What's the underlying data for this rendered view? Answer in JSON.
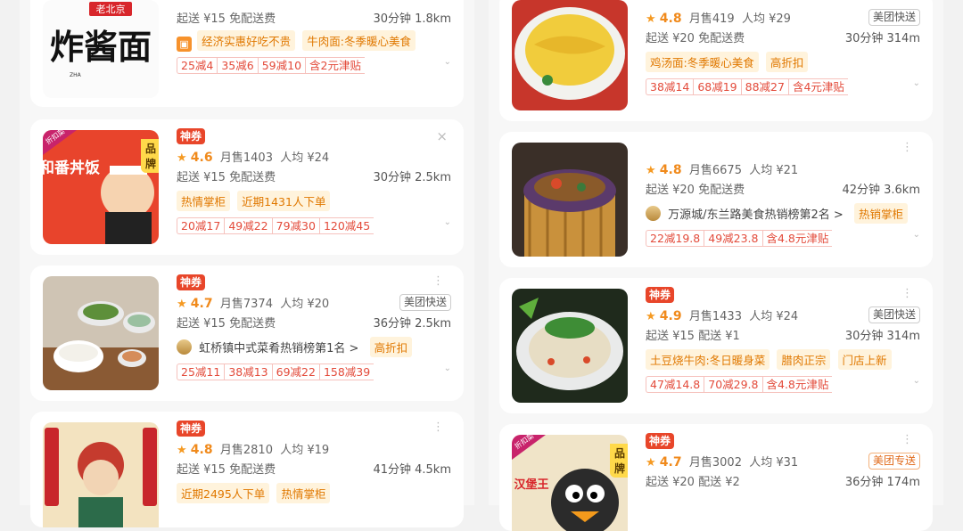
{
  "left": [
    {
      "name_art": "炸酱面",
      "name_art_top": "老北京",
      "delivery": "起送 ¥15  免配送费",
      "time_dist": "30分钟 1.8km",
      "tags": [
        "经济实惠好吃不贵",
        "牛肉面:冬季暖心美食"
      ],
      "deals": [
        "25减4",
        "35减6",
        "59减10",
        "含2元津贴"
      ]
    },
    {
      "brand": "品牌",
      "badge": "神券",
      "rating": "4.6",
      "sales": "月售1403",
      "avg": "人均 ¥24",
      "delivery": "起送 ¥15  免配送费",
      "time_dist": "30分钟 2.5km",
      "tags": [
        "热情掌柜",
        "近期1431人下单"
      ],
      "deals": [
        "20减17",
        "49减22",
        "79减30",
        "120减45"
      ],
      "thumb_text": "和番丼饭"
    },
    {
      "badge": "神券",
      "rating": "4.7",
      "sales": "月售7374",
      "avg": "人均 ¥20",
      "quick": "美团快送",
      "delivery": "起送 ¥15  免配送费",
      "time_dist": "36分钟 2.5km",
      "rank": "虹桥镇中式菜肴热销榜第1名 >",
      "tags": [
        "高折扣"
      ],
      "deals": [
        "25减11",
        "38减13",
        "69减22",
        "158减39"
      ]
    },
    {
      "badge": "神券",
      "rating": "4.8",
      "sales": "月售2810",
      "avg": "人均 ¥19",
      "delivery": "起送 ¥15  免配送费",
      "time_dist": "41分钟 4.5km",
      "tags": [
        "近期2495人下单",
        "热情掌柜"
      ]
    }
  ],
  "right": [
    {
      "rating": "4.8",
      "sales": "月售419",
      "avg": "人均 ¥29",
      "quick": "美团快送",
      "delivery": "起送 ¥20  免配送费",
      "time_dist": "30分钟 314m",
      "tags": [
        "鸡汤面:冬季暖心美食",
        "高折扣"
      ],
      "deals": [
        "38减14",
        "68减19",
        "88减27",
        "含4元津贴"
      ]
    },
    {
      "rating": "4.8",
      "sales": "月售6675",
      "avg": "人均 ¥21",
      "delivery": "起送 ¥20  免配送费",
      "time_dist": "42分钟 3.6km",
      "rank": "万源城/东兰路美食热销榜第2名 >",
      "tags": [
        "热销掌柜"
      ],
      "deals": [
        "22减19.8",
        "49减23.8",
        "含4.8元津贴"
      ]
    },
    {
      "badge": "神券",
      "rating": "4.9",
      "sales": "月售1433",
      "avg": "人均 ¥24",
      "quick": "美团快送",
      "delivery": "起送 ¥15  配送 ¥1",
      "time_dist": "30分钟 314m",
      "tags": [
        "土豆烧牛肉:冬日暖身菜",
        "腊肉正宗",
        "门店上新"
      ],
      "deals": [
        "47减14.8",
        "70减29.8",
        "含4.8元津贴"
      ]
    },
    {
      "brand": "品牌",
      "badge": "神券",
      "rating": "4.7",
      "sales": "月售3002",
      "avg": "人均 ¥31",
      "quick": "美团专送",
      "delivery": "起送 ¥20  配送 ¥2",
      "time_dist": "36分钟 174m",
      "thumb_text": "汉堡王"
    }
  ],
  "common": {
    "star": "★",
    "more": "⋮",
    "close": "×",
    "chevron": "⌄",
    "discount_badge": "折扣菜"
  }
}
